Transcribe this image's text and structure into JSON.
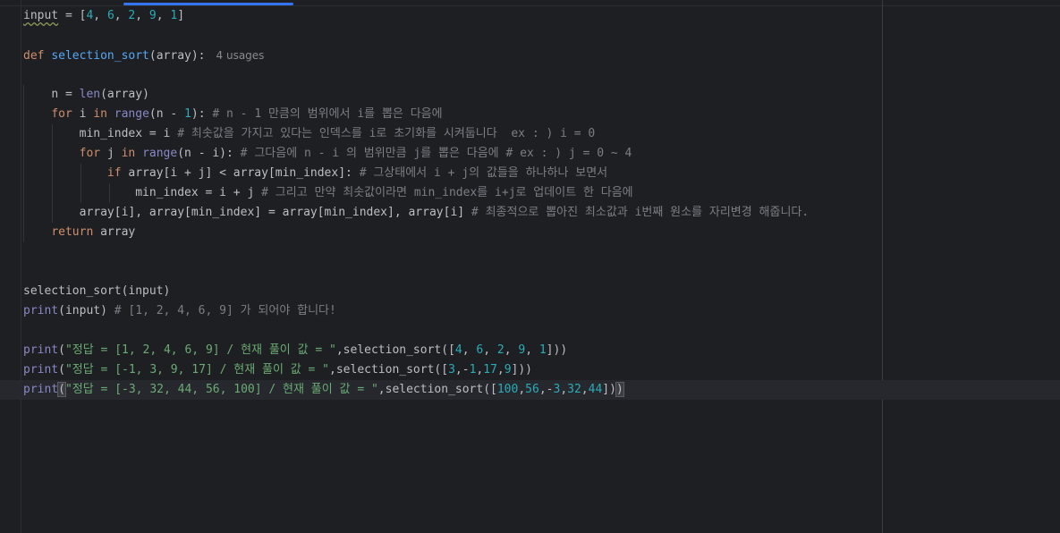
{
  "editor": {
    "usages_hint": "4 usages",
    "lines": {
      "l1": {
        "a": "input",
        "b": " = [",
        "c": "4",
        "d": ", ",
        "e": "6",
        "f": ", ",
        "g": "2",
        "h": ", ",
        "i": "9",
        "j": ", ",
        "k": "1",
        "l": "]"
      },
      "l3": {
        "kw": "def",
        "sp": " ",
        "fn": "selection_sort",
        "rest": "(array):"
      },
      "l5": {
        "a": "n = ",
        "b": "len",
        "c": "(array)"
      },
      "l6": {
        "kw1": "for",
        "a": " i ",
        "kw2": "in",
        "sp": " ",
        "b": "range",
        "c": "(n - ",
        "d": "1",
        "e": "): ",
        "cm": "# n - 1 만큼의 범위에서 i를 뽑은 다음에"
      },
      "l7": {
        "a": "min_index = i ",
        "cm": "# 최솟값을 가지고 있다는 인덱스를 i로 초기화를 시켜둡니다  ex : ) i = 0"
      },
      "l8": {
        "kw1": "for",
        "a": " j ",
        "kw2": "in",
        "sp": " ",
        "b": "range",
        "c": "(n - i): ",
        "cm": "# 그다음에 n - i 의 범위만큼 j를 뽑은 다음에 # ex : ) j = 0 ~ 4"
      },
      "l9": {
        "kw": "if",
        "a": " array[i + j] < array[min_index]: ",
        "cm": "# 그상태에서 i + j의 값들을 하나하나 보면서"
      },
      "l10": {
        "a": "min_index = i + j ",
        "cm": "# 그리고 만약 최솟값이라면 min_index를 i+j로 업데이트 한 다음에"
      },
      "l11": {
        "a": "array[i], array[min_index] = array[min_index], array[i] ",
        "cm": "# 최종적으로 뽑아진 최소값과 i번째 원소를 자리변경 해줍니다."
      },
      "l12": {
        "kw": "return",
        "a": " array"
      },
      "l15": {
        "a": "selection_sort(input)"
      },
      "l16": {
        "b": "print",
        "a": "(input) ",
        "cm": "# [1, 2, 4, 6, 9] 가 되어야 합니다!"
      },
      "l18": {
        "b": "print",
        "p": "(",
        "s": "\"정답 = [1, 2, 4, 6, 9] / 현재 풀이 값 = \"",
        "a": ",selection_sort([",
        "n1": "4",
        "c1": ", ",
        "n2": "6",
        "c2": ", ",
        "n3": "2",
        "c3": ", ",
        "n4": "9",
        "c4": ", ",
        "n5": "1",
        "e": "]))"
      },
      "l19": {
        "b": "print",
        "p": "(",
        "s": "\"정답 = [-1, 3, 9, 17] / 현재 풀이 값 = \"",
        "a": ",selection_sort([",
        "n1": "3",
        "c1": ",-",
        "n2": "1",
        "c2": ",",
        "n3": "17",
        "c3": ",",
        "n4": "9",
        "e": "]))"
      },
      "l20": {
        "b": "print",
        "p": "(",
        "s": "\"정답 = [-3, 32, 44, 56, 100] / 현재 풀이 값 = \"",
        "a": ",selection_sort([",
        "n1": "100",
        "c1": ",",
        "n2": "56",
        "c2": ",-",
        "n3": "3",
        "c3": ",",
        "n4": "32",
        "c4": ",",
        "n5": "44",
        "e": "]",
        "e2": ")",
        "e3": ")"
      }
    }
  },
  "colors": {
    "background": "#1e1f22",
    "keyword": "#cf8e6d",
    "function": "#56a8f5",
    "builtin": "#8888c6",
    "number": "#2aacb8",
    "string": "#6aab73",
    "comment": "#7a7e85",
    "tab_accent": "#3574f0"
  }
}
